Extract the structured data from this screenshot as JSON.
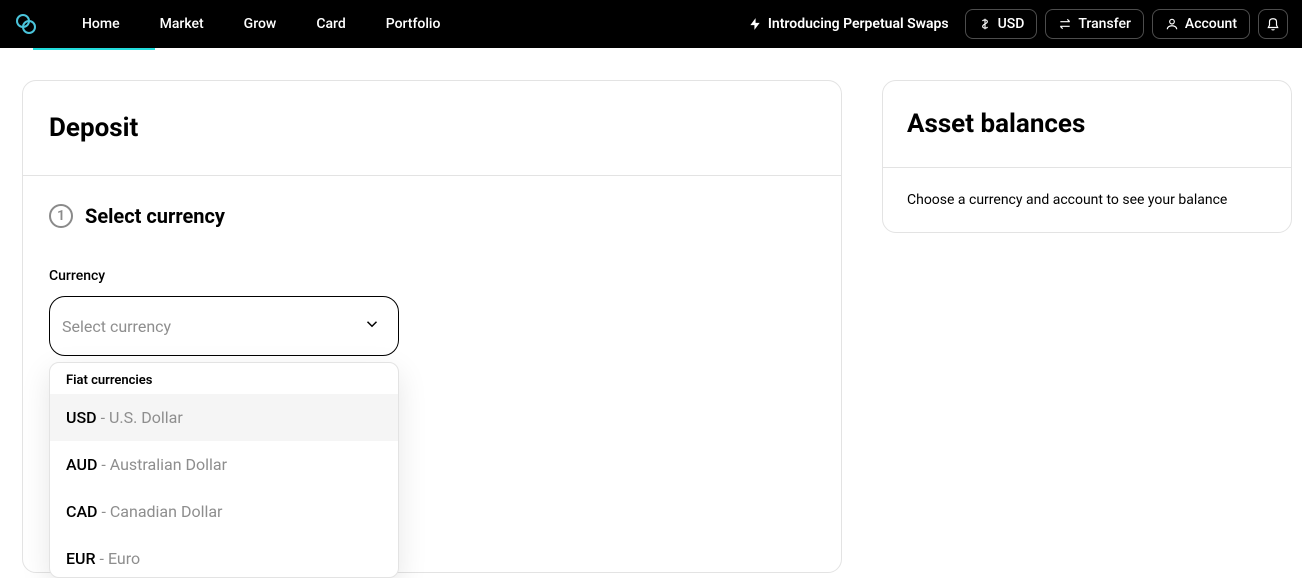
{
  "header": {
    "nav": {
      "items": [
        "Home",
        "Market",
        "Grow",
        "Card",
        "Portfolio"
      ]
    },
    "promo": "Introducing Perpetual Swaps",
    "currency_button": "USD",
    "transfer_button": "Transfer",
    "account_button": "Account"
  },
  "main": {
    "title": "Deposit",
    "step": {
      "number": "1",
      "title": "Select currency"
    },
    "currency_field": {
      "label": "Currency",
      "placeholder": "Select currency",
      "group_label": "Fiat currencies",
      "options": [
        {
          "code": "USD",
          "name": "U.S. Dollar"
        },
        {
          "code": "AUD",
          "name": "Australian Dollar"
        },
        {
          "code": "CAD",
          "name": "Canadian Dollar"
        },
        {
          "code": "EUR",
          "name": "Euro"
        }
      ]
    }
  },
  "sidebar": {
    "title": "Asset balances",
    "empty_text": "Choose a currency and account to see your balance"
  }
}
